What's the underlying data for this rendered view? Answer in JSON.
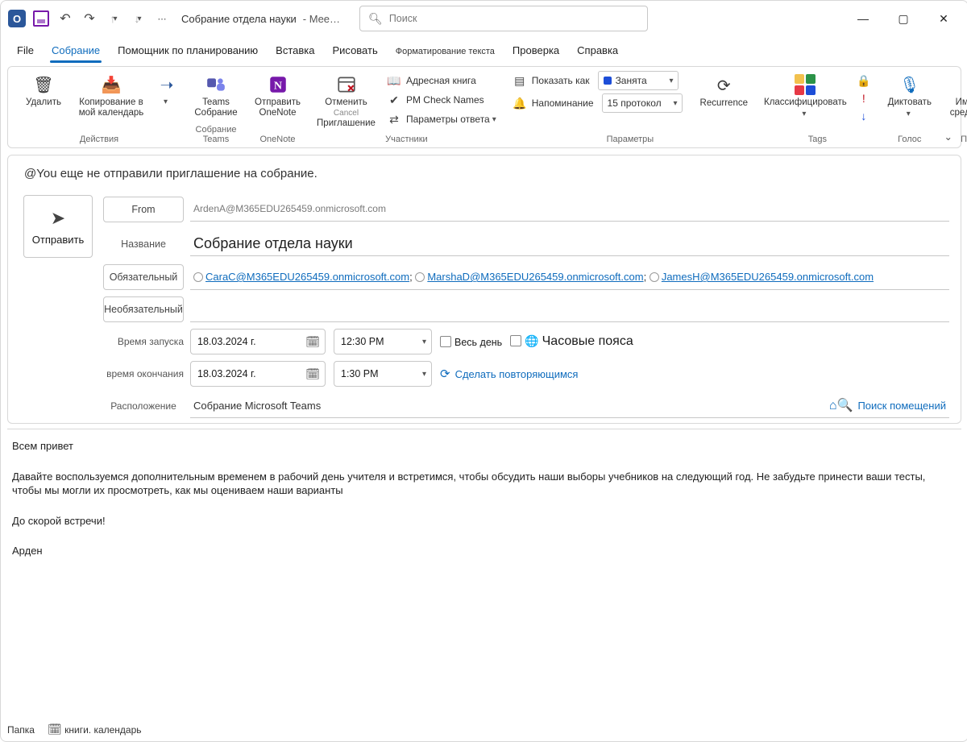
{
  "titlebar": {
    "doc_title": "Собрание отдела науки",
    "doc_suffix": "-  Mee…",
    "search_placeholder": "Поиск"
  },
  "tabs": {
    "file": "File",
    "meeting": "Собрание",
    "scheduling": "Помощник по планированию",
    "insert": "Вставка",
    "draw": "Рисовать",
    "format_text": "Форматирование текста",
    "review": "Проверка",
    "help": "Справка"
  },
  "ribbon": {
    "group_actions_label": "Действия",
    "delete": "Удалить",
    "copy_to_cal": "Копирование в мой календарь",
    "group_teams_label": "Собрание Teams",
    "teams_meeting": "Teams Собрание",
    "group_onenote": "OneNote",
    "send_onenote": "Отправить OneNote",
    "group_attendees": "Участники",
    "cancel_invite_top": "Отменить",
    "cancel_invite_bottom": "Приглашение",
    "address_book": "Адресная книга",
    "pm_check_names": "PM Check Names",
    "response_options": "Параметры ответа",
    "group_options": "Параметры",
    "show_as": "Показать как",
    "show_as_value": "Занята",
    "reminder": "Напоминание",
    "reminder_value": "15 протокол",
    "recurrence": "Recurrence",
    "group_tags": "Tags",
    "categorize": "Классифицировать",
    "private": "",
    "high": "",
    "low": "",
    "group_voice": "Голос",
    "dictate": "Диктовать",
    "group_immersive": "Погружения",
    "immersive": "Иммерсивное средство чтения"
  },
  "notice": "@You еще не отправили приглашение на собрание.",
  "form": {
    "send": "Отправить",
    "from_label": "From",
    "from_value": "ArdenA@M365EDU265459.onmicrosoft.com",
    "title_label": "Название",
    "title_value": "Собрание отдела науки",
    "required_label": "Обязательный",
    "required_list": [
      "CaraC@M365EDU265459.onmicrosoft.com",
      "MarshaD@M365EDU265459.onmicrosoft.com",
      "JamesH@M365EDU265459.onmicrosoft.com"
    ],
    "optional_label": "Необязательный",
    "start_label": "Время запуска",
    "start_date": "18.03.2024 г.",
    "start_time": "12:30 PM",
    "end_label": "время окончания",
    "end_date": "18.03.2024 г.",
    "end_time": "1:30 PM",
    "all_day": "Весь день",
    "timezones": "Часовые пояса",
    "make_recurring": "Сделать повторяющимся",
    "location_label": "Расположение",
    "location_value": "Собрание Microsoft Teams",
    "find_rooms": "Поиск помещений"
  },
  "body": {
    "p1": "Всем привет",
    "p2": "Давайте воспользуемся дополнительным временем в рабочий день учителя и встретимся, чтобы обсудить наши выборы учебников на следующий год. Не забудьте принести ваши тесты, чтобы мы могли их просмотреть, как мы оцениваем наши варианты",
    "p3": "До скорой встречи!",
    "p4": "Арден"
  },
  "footer": {
    "folder_label": "Папка",
    "calendar_label": "книги. календарь"
  }
}
